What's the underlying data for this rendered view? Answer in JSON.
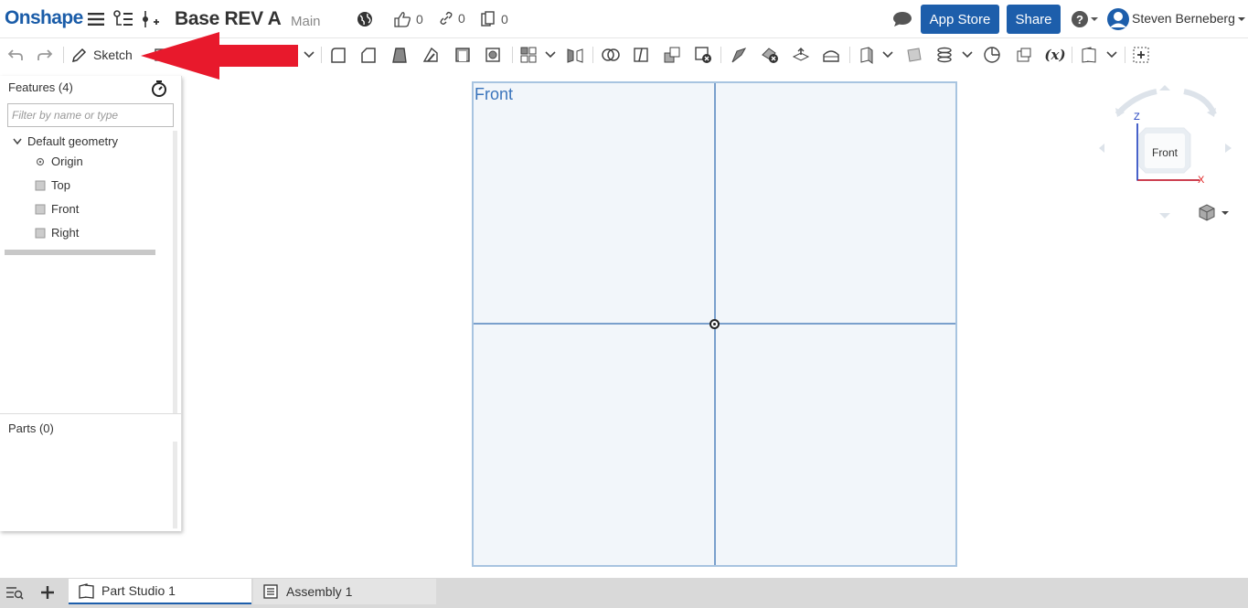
{
  "topbar": {
    "logo": "Onshape",
    "doc_title": "Base REV A",
    "branch": "Main",
    "likes_count": "0",
    "links_count": "0",
    "copies_count": "0",
    "app_store_label": "App Store",
    "share_label": "Share",
    "user_name": "Steven Berneberg",
    "brand_color": "#1d5eab"
  },
  "toolbar": {
    "sketch_label": "Sketch"
  },
  "features_panel": {
    "title": "Features (4)",
    "filter_placeholder": "Filter by name or type",
    "tree": {
      "group_label": "Default geometry",
      "items": [
        {
          "label": "Origin",
          "icon": "origin-icon"
        },
        {
          "label": "Top",
          "icon": "plane-icon"
        },
        {
          "label": "Front",
          "icon": "plane-icon"
        },
        {
          "label": "Right",
          "icon": "plane-icon"
        }
      ]
    },
    "parts_title": "Parts (0)"
  },
  "viewport": {
    "plane_label": "Front",
    "viewcube_face": "Front",
    "axis_z": "Z",
    "axis_x": "X"
  },
  "tabs": [
    {
      "label": "Part Studio 1",
      "active": true
    },
    {
      "label": "Assembly 1",
      "active": false
    }
  ]
}
